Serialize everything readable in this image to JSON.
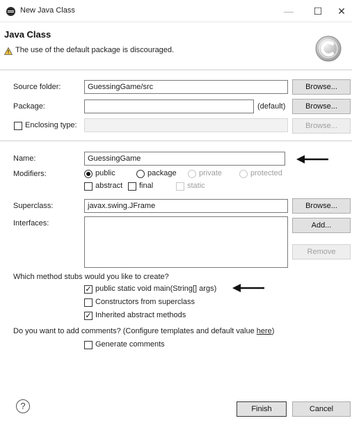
{
  "window": {
    "title": "New Java Class",
    "minimize": "—",
    "maximize": "☐",
    "close": "✕",
    "app_icon": "eclipse-icon"
  },
  "header": {
    "title": "Java Class",
    "message": "The use of the default package is discouraged.",
    "warning_icon": "warning-icon",
    "wizard_icon": "class-wizard-icon"
  },
  "source_folder": {
    "label": "Source folder:",
    "value": "GuessingGame/src",
    "browse": "Browse..."
  },
  "package": {
    "label": "Package:",
    "value": "",
    "default_hint": "(default)",
    "browse": "Browse..."
  },
  "enclosing_type": {
    "label": "Enclosing type:",
    "value": "",
    "browse": "Browse...",
    "checked": false
  },
  "name": {
    "label": "Name:",
    "value": "GuessingGame"
  },
  "modifiers": {
    "label": "Modifiers:",
    "options": [
      "public",
      "package",
      "private",
      "protected"
    ],
    "selected": "public",
    "abstract": "abstract",
    "final": "final",
    "static": "static"
  },
  "superclass": {
    "label": "Superclass:",
    "value": "javax.swing.JFrame",
    "browse": "Browse..."
  },
  "interfaces": {
    "label": "Interfaces:",
    "add": "Add...",
    "remove": "Remove"
  },
  "stubs": {
    "question": "Which method stubs would you like to create?",
    "main": "public static void main(String[] args)",
    "constructors": "Constructors from superclass",
    "inherited": "Inherited abstract methods"
  },
  "comments": {
    "question_prefix": "Do you want to add comments? (Configure templates and default value ",
    "question_link": "here",
    "question_suffix": ")",
    "generate": "Generate comments"
  },
  "footer": {
    "help": "?",
    "finish": "Finish",
    "cancel": "Cancel"
  }
}
